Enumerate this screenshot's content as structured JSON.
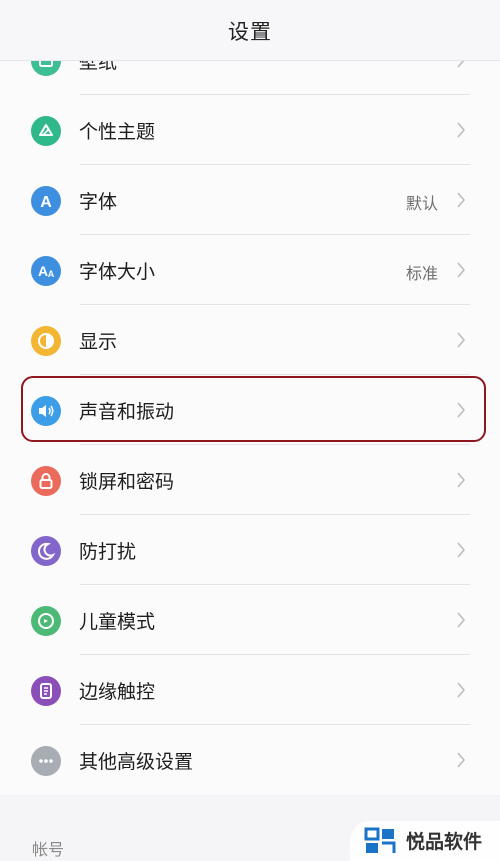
{
  "header": {
    "title": "设置"
  },
  "list": {
    "items": [
      {
        "key": "wallpaper",
        "label": "壁纸",
        "value": "",
        "icon": "wallpaper-icon",
        "color": "#3dbf93"
      },
      {
        "key": "theme",
        "label": "个性主题",
        "value": "",
        "icon": "theme-icon",
        "color": "#2fb98a"
      },
      {
        "key": "font",
        "label": "字体",
        "value": "默认",
        "icon": "font-icon",
        "color": "#3f8fe0"
      },
      {
        "key": "font-size",
        "label": "字体大小",
        "value": "标准",
        "icon": "font-size-icon",
        "color": "#3f8fe0"
      },
      {
        "key": "display",
        "label": "显示",
        "value": "",
        "icon": "display-icon",
        "color": "#f2b632"
      },
      {
        "key": "sound",
        "label": "声音和振动",
        "value": "",
        "icon": "sound-icon",
        "color": "#3b9ee6"
      },
      {
        "key": "lock",
        "label": "锁屏和密码",
        "value": "",
        "icon": "lock-icon",
        "color": "#ea6a5c"
      },
      {
        "key": "dnd",
        "label": "防打扰",
        "value": "",
        "icon": "moon-icon",
        "color": "#8266c9"
      },
      {
        "key": "kids",
        "label": "儿童模式",
        "value": "",
        "icon": "kids-icon",
        "color": "#4cba76"
      },
      {
        "key": "edge",
        "label": "边缘触控",
        "value": "",
        "icon": "edge-icon",
        "color": "#8b4fb8"
      },
      {
        "key": "other",
        "label": "其他高级设置",
        "value": "",
        "icon": "more-icon",
        "color": "#a8acb3"
      }
    ]
  },
  "section": {
    "label": "帐号"
  },
  "watermark": {
    "text": "悦品软件"
  },
  "colors": {
    "highlight": "#8e1820"
  }
}
